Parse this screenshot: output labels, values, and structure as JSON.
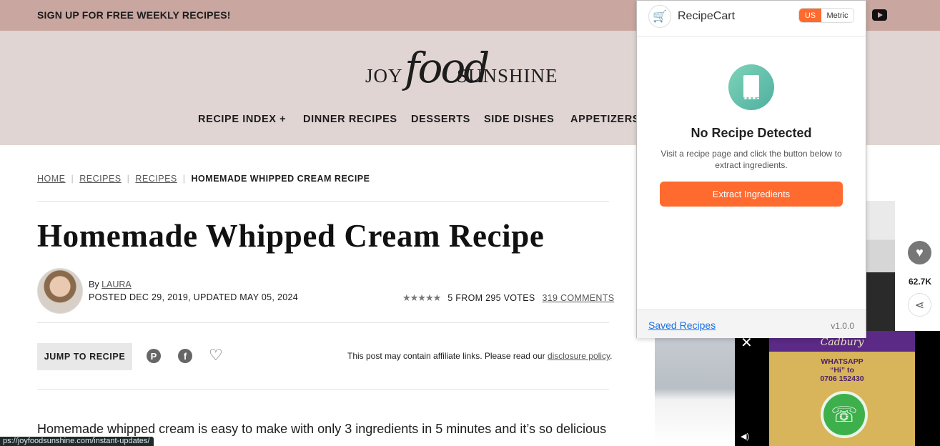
{
  "topbar": {
    "signup": "SIGN UP FOR FREE WEEKLY RECIPES!"
  },
  "logo": {
    "w1": "JOY",
    "w2": "food",
    "w3": "SUNSHINE"
  },
  "nav": {
    "items": [
      "RECIPE INDEX +",
      "DINNER RECIPES",
      "DESSERTS",
      "SIDE DISHES",
      "APPETIZERS"
    ]
  },
  "breadcrumb": {
    "home": "HOME",
    "recipes1": "RECIPES",
    "recipes2": "RECIPES",
    "current": "HOMEMADE WHIPPED CREAM RECIPE"
  },
  "article": {
    "title": "Homemade Whipped Cream Recipe",
    "by_prefix": "By",
    "author": "LAURA",
    "posted": "POSTED DEC 29, 2019, UPDATED MAY 05, 2024",
    "stars": "★★★★★",
    "rating_text": "5 FROM 295 VOTES",
    "comments": "319 COMMENTS",
    "jump": "JUMP TO RECIPE",
    "affiliate_prefix": "This post may contain affiliate links. Please read our",
    "affiliate_link": "disclosure policy",
    "affiliate_suffix": ".",
    "body": "Homemade whipped cream is easy to make with only 3 ingredients in 5 minutes and it’s so delicious"
  },
  "status_url": "ps://joyfoodsunshine.com/instant-updates/",
  "floating": {
    "count": "62.7K"
  },
  "ad": {
    "brand": "Cadbury",
    "label1": "WHATSAPP",
    "label2": "“Hi” to",
    "label3": "0706 152430",
    "close": "✕"
  },
  "extension": {
    "name": "RecipeCart",
    "unit_us": "US",
    "unit_metric": "Metric",
    "heading": "No Recipe Detected",
    "description": "Visit a recipe page and click the button below to extract ingredients.",
    "button": "Extract Ingredients",
    "saved": "Saved Recipes",
    "version": "v1.0.0",
    "accent": "#ff6a2f"
  }
}
